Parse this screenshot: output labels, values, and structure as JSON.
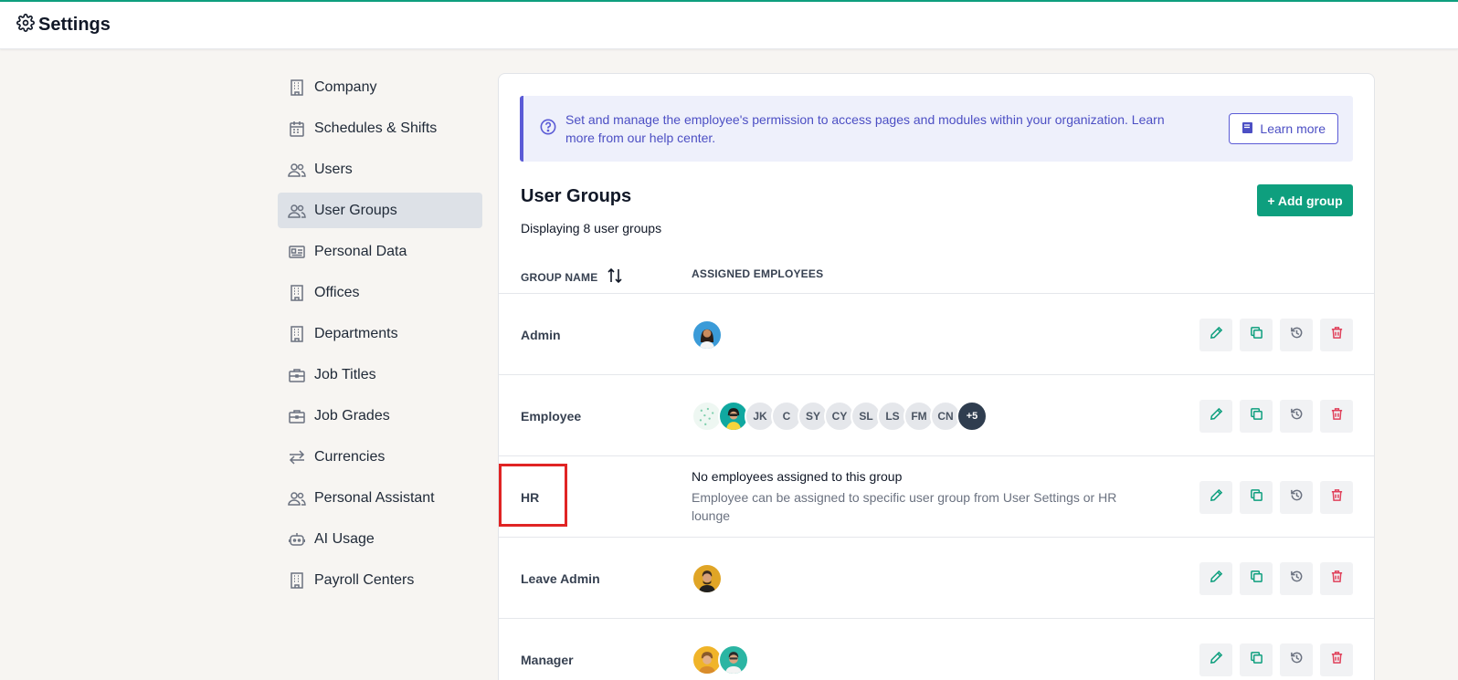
{
  "header": {
    "title": "Settings",
    "icon": "gear-icon"
  },
  "sidebar": {
    "items": [
      {
        "label": "Company",
        "icon": "building-icon"
      },
      {
        "label": "Schedules & Shifts",
        "icon": "calendar-icon"
      },
      {
        "label": "Users",
        "icon": "users-icon"
      },
      {
        "label": "User Groups",
        "icon": "users-icon",
        "active": true
      },
      {
        "label": "Personal Data",
        "icon": "id-card-icon"
      },
      {
        "label": "Offices",
        "icon": "building-icon"
      },
      {
        "label": "Departments",
        "icon": "building-icon"
      },
      {
        "label": "Job Titles",
        "icon": "briefcase-icon"
      },
      {
        "label": "Job Grades",
        "icon": "briefcase-icon"
      },
      {
        "label": "Currencies",
        "icon": "exchange-icon"
      },
      {
        "label": "Personal Assistant",
        "icon": "users-icon"
      },
      {
        "label": "AI Usage",
        "icon": "robot-icon"
      },
      {
        "label": "Payroll Centers",
        "icon": "building-icon"
      }
    ]
  },
  "banner": {
    "text": "Set and manage the employee's permission to access pages and modules within your organization. Learn more from our help center.",
    "learn_more": "Learn more"
  },
  "section": {
    "title": "User Groups",
    "subtitle": "Displaying 8 user groups",
    "add_button": "+ Add group"
  },
  "table": {
    "col_group": "GROUP NAME",
    "col_employees": "ASSIGNED EMPLOYEES",
    "rows": [
      {
        "name": "Admin",
        "avatars": [
          "photo"
        ]
      },
      {
        "name": "Employee",
        "avatars": [
          "pattern",
          "photo",
          "JK",
          "C",
          "SY",
          "CY",
          "SL",
          "LS",
          "FM",
          "CN"
        ],
        "more": "+5"
      },
      {
        "name": "HR",
        "empty_title": "No employees assigned to this group",
        "empty_sub": "Employee can be assigned to specific user group from User Settings or HR lounge"
      },
      {
        "name": "Leave Admin",
        "avatars": [
          "photo"
        ]
      },
      {
        "name": "Manager",
        "avatars": [
          "photo",
          "photo"
        ]
      }
    ]
  },
  "colors": {
    "accent": "#0e9f7e",
    "banner": "#5b5bd6",
    "danger": "#e02424"
  }
}
